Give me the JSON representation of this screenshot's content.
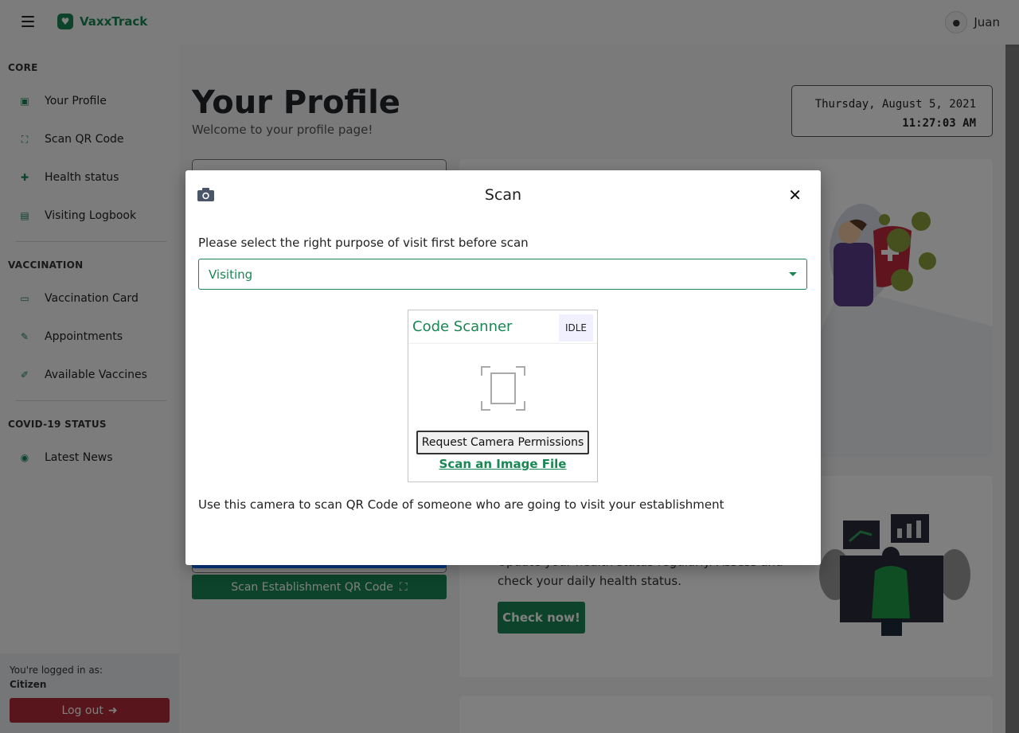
{
  "app": {
    "name": "VaxxTrack"
  },
  "user": {
    "name": "Juan"
  },
  "sidebar": {
    "sections": [
      {
        "heading": "CORE",
        "items": [
          {
            "label": "Your Profile",
            "icon": "id-badge-icon"
          },
          {
            "label": "Scan QR Code",
            "icon": "qr-scan-icon"
          },
          {
            "label": "Health status",
            "icon": "medkit-icon"
          },
          {
            "label": "Visiting Logbook",
            "icon": "book-icon"
          }
        ]
      },
      {
        "heading": "VACCINATION",
        "items": [
          {
            "label": "Vaccination Card",
            "icon": "id-card-icon"
          },
          {
            "label": "Appointments",
            "icon": "calendar-edit-icon"
          },
          {
            "label": "Available Vaccines",
            "icon": "syringe-icon"
          }
        ]
      },
      {
        "heading": "COVID-19 STATUS",
        "items": [
          {
            "label": "Latest News",
            "icon": "rss-icon"
          }
        ]
      }
    ],
    "footer": {
      "logged_in_as": "You're logged in as:",
      "role": "Citizen",
      "logout": "Log out"
    }
  },
  "main": {
    "title": "Your Profile",
    "subtitle": "Welcome to your profile page!",
    "clock": {
      "date": "Thursday, August 5, 2021",
      "time": "11:27:03 AM"
    },
    "health_text": "Update your health status regularly. Assess and check your daily health status.",
    "check_button": "Check now!",
    "scan_establishment_button": "Scan Establishment QR Code"
  },
  "modal": {
    "title": "Scan",
    "prompt": "Please select the right purpose of visit first before scan",
    "purpose": {
      "selected": "Visiting"
    },
    "scanner": {
      "title": "Code Scanner",
      "status": "IDLE",
      "permission_button": "Request Camera Permissions",
      "image_link": "Scan an Image File"
    },
    "footer_text": "Use this camera to scan QR Code of someone who are going to visit your establishment"
  },
  "colors": {
    "accent": "#198754",
    "danger": "#b02a37",
    "primary": "#0d6efd"
  }
}
